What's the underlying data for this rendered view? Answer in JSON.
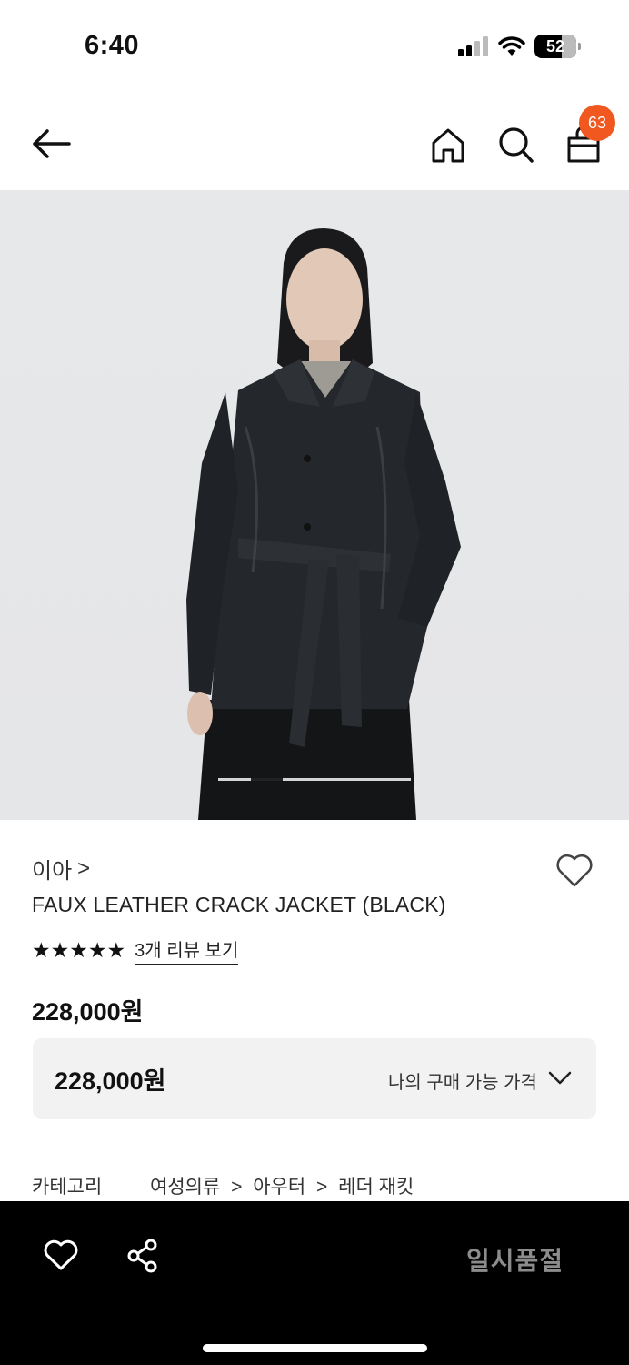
{
  "status_bar": {
    "time": "6:40",
    "battery": "52"
  },
  "nav": {
    "cart_count": "63"
  },
  "product": {
    "brand": "이아",
    "brand_chevron": ">",
    "name": "FAUX LEATHER CRACK JACKET (BLACK)",
    "rating_stars": 5,
    "stars": "★★★★★",
    "review_link": "3개 리뷰 보기",
    "price": "228,000원",
    "image_count": 6,
    "current_image": 2
  },
  "price_box": {
    "price": "228,000원",
    "label": "나의 구매 가능 가격"
  },
  "category": {
    "label": "카테고리",
    "path": [
      "여성의류",
      ">",
      "아우터",
      ">",
      "레더 재킷"
    ]
  },
  "bottom_bar": {
    "status": "일시품절"
  },
  "colors": {
    "badge": "#f0581f",
    "bottom_bar": "#000000",
    "soldout_text": "#8c8c8c"
  }
}
